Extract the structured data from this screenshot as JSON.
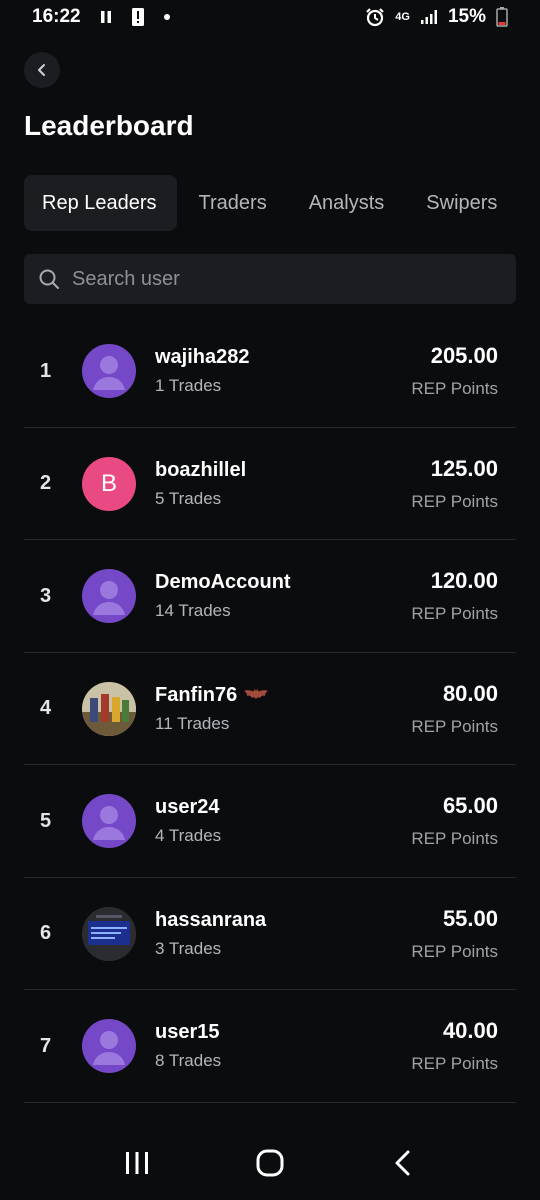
{
  "status_bar": {
    "time": "16:22",
    "network": "4G",
    "battery": "15%",
    "icons": [
      "pause-icon",
      "alert-icon",
      "dot-icon",
      "alarm-icon",
      "signal-icon",
      "battery-icon"
    ]
  },
  "header": {
    "back_icon": "chevron-left-icon",
    "title": "Leaderboard"
  },
  "tabs": [
    {
      "label": "Rep Leaders",
      "active": true
    },
    {
      "label": "Traders",
      "active": false
    },
    {
      "label": "Analysts",
      "active": false
    },
    {
      "label": "Swipers",
      "active": false
    }
  ],
  "search": {
    "placeholder": "Search user",
    "value": ""
  },
  "leaders": [
    {
      "rank": "1",
      "username": "wajiha282",
      "trades": "1 Trades",
      "points": "205.00",
      "points_label": "REP Points",
      "avatar": "default"
    },
    {
      "rank": "2",
      "username": "boazhillel",
      "trades": "5 Trades",
      "points": "125.00",
      "points_label": "REP Points",
      "avatar": "letter",
      "avatar_letter": "B"
    },
    {
      "rank": "3",
      "username": "DemoAccount",
      "trades": "14 Trades",
      "points": "120.00",
      "points_label": "REP Points",
      "avatar": "default"
    },
    {
      "rank": "4",
      "username": "Fanfin76",
      "trades": "11 Trades",
      "points": "80.00",
      "points_label": "REP Points",
      "avatar": "photo",
      "badge_icon": "bat-icon"
    },
    {
      "rank": "5",
      "username": "user24",
      "trades": "4 Trades",
      "points": "65.00",
      "points_label": "REP Points",
      "avatar": "default"
    },
    {
      "rank": "6",
      "username": "hassanrana",
      "trades": "3 Trades",
      "points": "55.00",
      "points_label": "REP Points",
      "avatar": "screen"
    },
    {
      "rank": "7",
      "username": "user15",
      "trades": "8 Trades",
      "points": "40.00",
      "points_label": "REP Points",
      "avatar": "default"
    }
  ],
  "nav_bar": {
    "icons": [
      "recent-apps-icon",
      "home-icon",
      "back-icon"
    ]
  },
  "colors": {
    "background": "#0b0c0e",
    "surface": "#1c1d20",
    "avatar_default": "#7448c6",
    "avatar_letter": "#ea4a84",
    "divider": "#26282c"
  }
}
